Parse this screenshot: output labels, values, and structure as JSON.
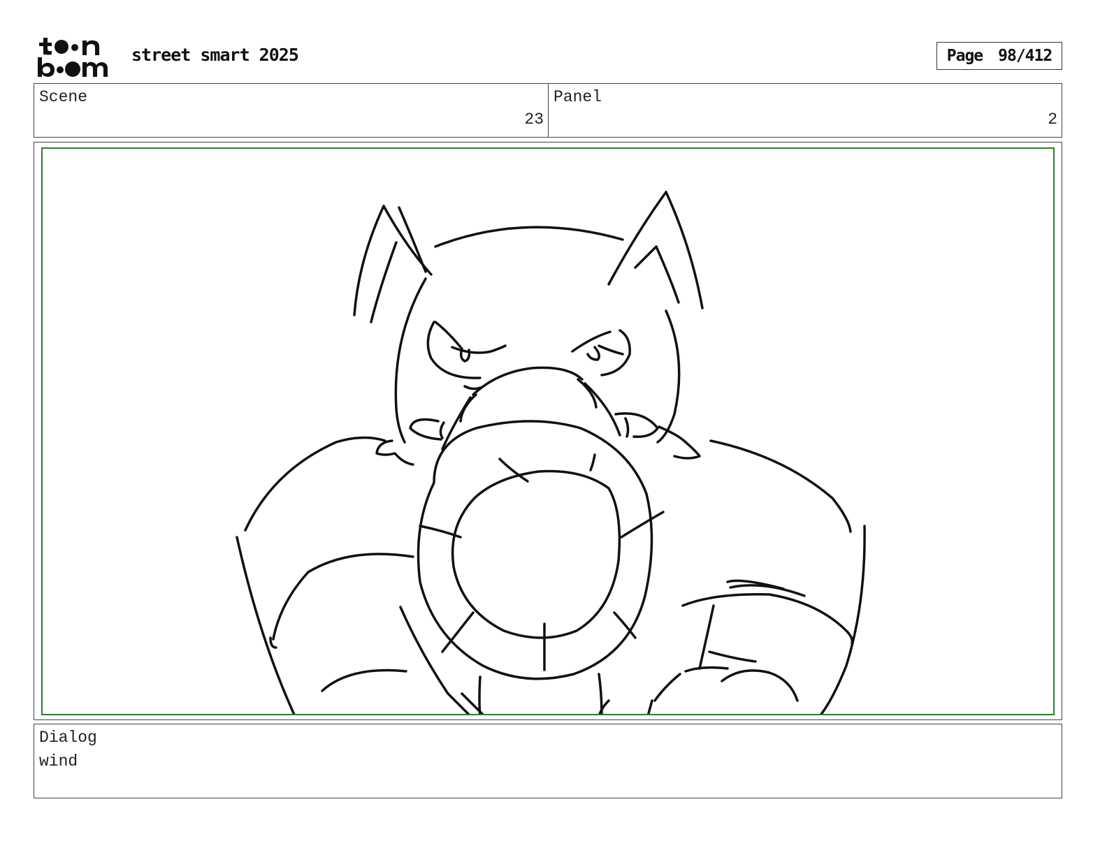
{
  "header": {
    "logo_alt": "toon boom",
    "project_title": "street smart 2025",
    "page_label": "Page",
    "page_value": "98/412"
  },
  "info": {
    "scene_label": "Scene",
    "scene_value": "23",
    "panel_label": "Panel",
    "panel_value": "2"
  },
  "dialog": {
    "label": "Dialog",
    "text": "wind"
  },
  "colors": {
    "safe_area_border": "#2e7d32",
    "ink": "#111111"
  }
}
